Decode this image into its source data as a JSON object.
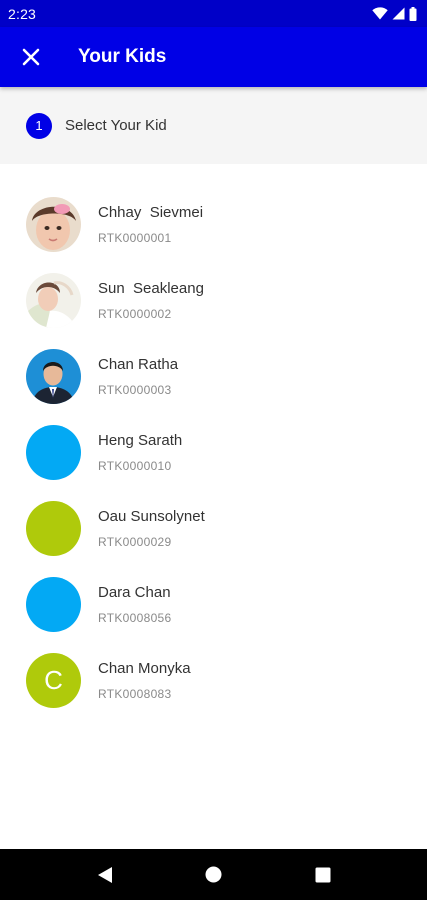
{
  "status_bar": {
    "time": "2:23",
    "icons": [
      "wifi-icon",
      "signal-icon",
      "battery-icon"
    ]
  },
  "app_bar": {
    "title": "Your Kids",
    "close_icon": "close-icon",
    "background": "#0000e6"
  },
  "step": {
    "number": "1",
    "label": "Select Your Kid"
  },
  "kids": [
    {
      "name": "Chhay  Sievmei",
      "id": "RTK0000001",
      "avatar": "photo"
    },
    {
      "name": "Sun  Seakleang",
      "id": "RTK0000002",
      "avatar": "photo"
    },
    {
      "name": "Chan Ratha",
      "id": "RTK0000003",
      "avatar": "photo"
    },
    {
      "name": "Heng Sarath",
      "id": "RTK0000010",
      "avatar_color": "#03a9f4",
      "avatar_letter": ""
    },
    {
      "name": "Oau Sunsolynet",
      "id": "RTK0000029",
      "avatar_color": "#afca0b",
      "avatar_letter": ""
    },
    {
      "name": "Dara Chan",
      "id": "RTK0008056",
      "avatar_color": "#03a9f4",
      "avatar_letter": ""
    },
    {
      "name": "Chan Monyka",
      "id": "RTK0008083",
      "avatar_color": "#afca0b",
      "avatar_letter": "C"
    }
  ],
  "nav_bar": {
    "buttons": [
      "back-icon",
      "home-icon",
      "recents-icon"
    ]
  }
}
